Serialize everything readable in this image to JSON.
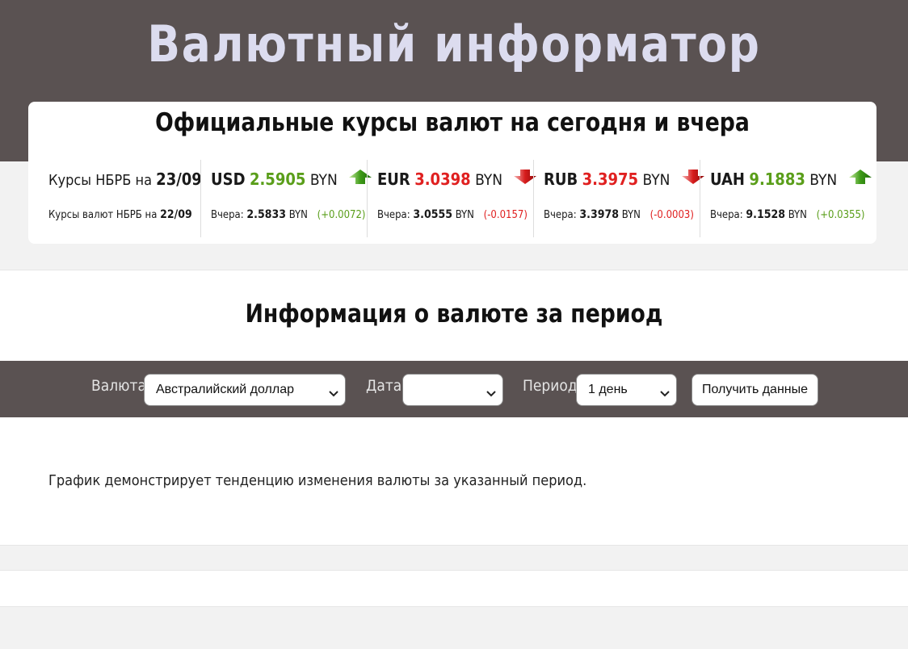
{
  "header": {
    "title": "Валютный информатор"
  },
  "rates": {
    "heading": "Официальные курсы валют на сегодня и вчера",
    "today_label": "Курсы НБРБ на",
    "today_date": "23/09",
    "yesterday_label": "Курсы валют НБРБ на",
    "yesterday_date": "22/09",
    "yesterday_prefix": "Вчера:",
    "currencies": [
      {
        "code": "USD",
        "rate": "2.5905",
        "unit": "BYN",
        "trend": "up",
        "yesterday": "2.5833",
        "change": "(+0.0072)"
      },
      {
        "code": "EUR",
        "rate": "3.0398",
        "unit": "BYN",
        "trend": "down",
        "yesterday": "3.0555",
        "change": "(-0.0157)"
      },
      {
        "code": "RUB",
        "rate": "3.3975",
        "unit": "BYN",
        "trend": "down",
        "yesterday": "3.3978",
        "change": "(-0.0003)"
      },
      {
        "code": "UAH",
        "rate": "9.1883",
        "unit": "BYN",
        "trend": "up",
        "yesterday": "9.1528",
        "change": "(+0.0355)"
      }
    ]
  },
  "period": {
    "heading": "Информация о валюте за период",
    "currency_label": "Валюта:",
    "currency_value": "Австралийский доллар",
    "date_label": "Дата:",
    "date_value": "",
    "period_label": "Период:",
    "period_value": "1 день",
    "submit_label": "Получить данные",
    "caption": "График демонстрирует тенденцию изменения валюты за указанный период."
  },
  "colors": {
    "up": "#5a9e1a",
    "down": "#e02020",
    "header_bg": "#5a5252",
    "title": "#dcdcef"
  },
  "icons": {
    "up": "arrow-up-icon",
    "down": "arrow-down-icon",
    "select": "chevron-down-icon"
  }
}
